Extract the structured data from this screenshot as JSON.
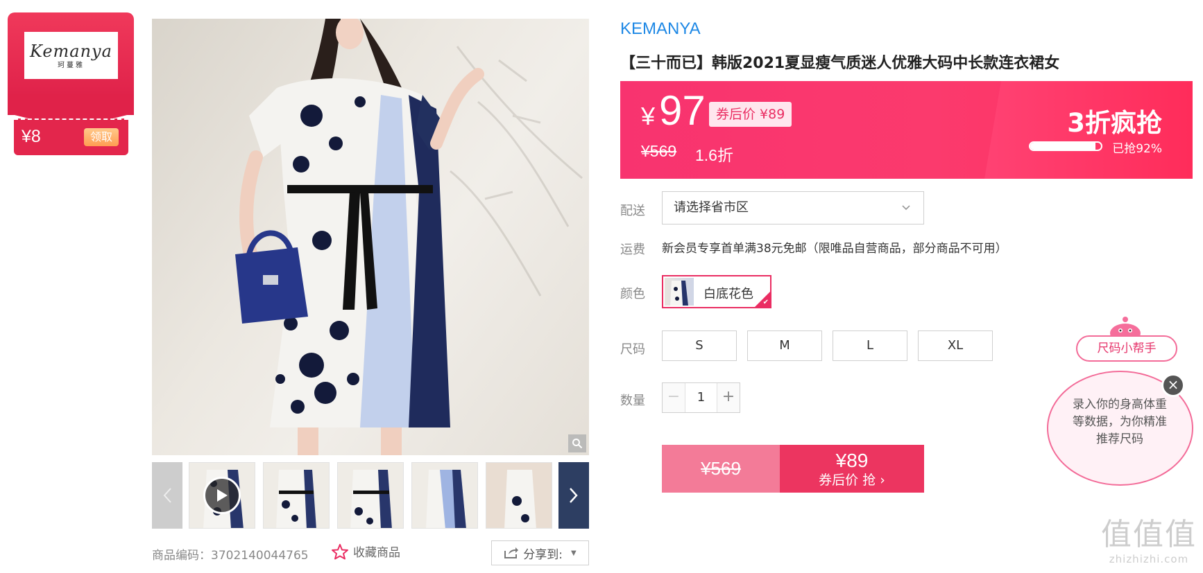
{
  "coupon": {
    "logo_text": "Kemanya",
    "logo_cn": "珂蔓雅",
    "amount": "¥8",
    "claim_label": "领取"
  },
  "product": {
    "brand": "KEMANYA",
    "title": "【三十而已】韩版2021夏显瘦气质迷人优雅大码中长款连衣裙女",
    "sku_label": "商品编码：3702140044765",
    "favorite_label": "收藏商品",
    "share_label": "分享到:"
  },
  "price_banner": {
    "yen": "¥",
    "price": "97",
    "after_coupon_tag": "券后价 ¥89",
    "original_price": "¥569",
    "discount": "1.6折",
    "flash_title": "3折疯抢",
    "sold_label": "已抢92%",
    "sold_progress": 0.92
  },
  "delivery": {
    "label": "配送",
    "placeholder": "请选择省市区"
  },
  "shipping": {
    "label": "运费",
    "text": "新会员专享首单满38元免邮（限唯品自营商品，部分商品不可用）"
  },
  "color": {
    "label": "颜色",
    "selected": "白底花色"
  },
  "size": {
    "label": "尺码",
    "options": [
      "S",
      "M",
      "L",
      "XL"
    ]
  },
  "quantity": {
    "label": "数量",
    "value": "1",
    "minus": "−",
    "plus": "+"
  },
  "buy_button": {
    "original": "¥569",
    "price": "¥89",
    "sub": "券后价 抢 ›"
  },
  "size_helper": {
    "chip_label": "尺码小帮手",
    "bubble_text": "录入你的身高体重等数据，为你精准推荐尺码",
    "close": "×"
  },
  "watermark": {
    "glyph": "值值值",
    "url": "zhizhizhi.com"
  },
  "colors": {
    "brand_blue": "#1e88e5",
    "accent_pink": "#ea2d62",
    "banner_pink": "#f8336f"
  }
}
